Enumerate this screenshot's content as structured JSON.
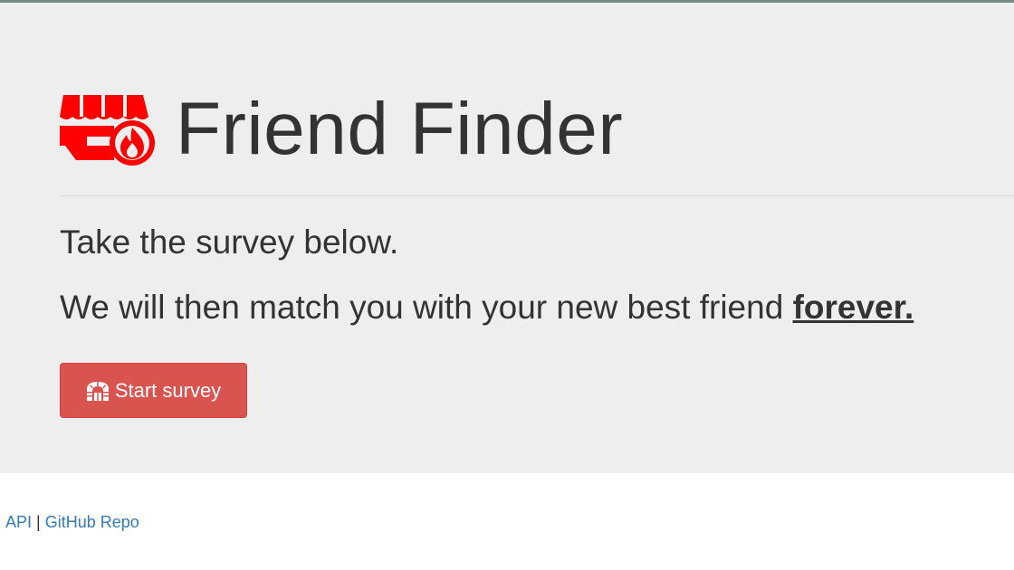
{
  "header": {
    "title": "Friend Finder",
    "logo_icon": "store-fire-icon",
    "logo_color": "#ff0000"
  },
  "intro": {
    "line1": "Take the survey below.",
    "line2_prefix": "We will then match you with your new best friend ",
    "line2_emphasis": "forever."
  },
  "actions": {
    "start_survey_label": "Start survey",
    "start_survey_icon": "archway-icon",
    "button_color": "#d9534f"
  },
  "footer": {
    "api_label": "API",
    "separator": "|",
    "github_label": "GitHub Repo",
    "link_color": "#337ab7"
  }
}
